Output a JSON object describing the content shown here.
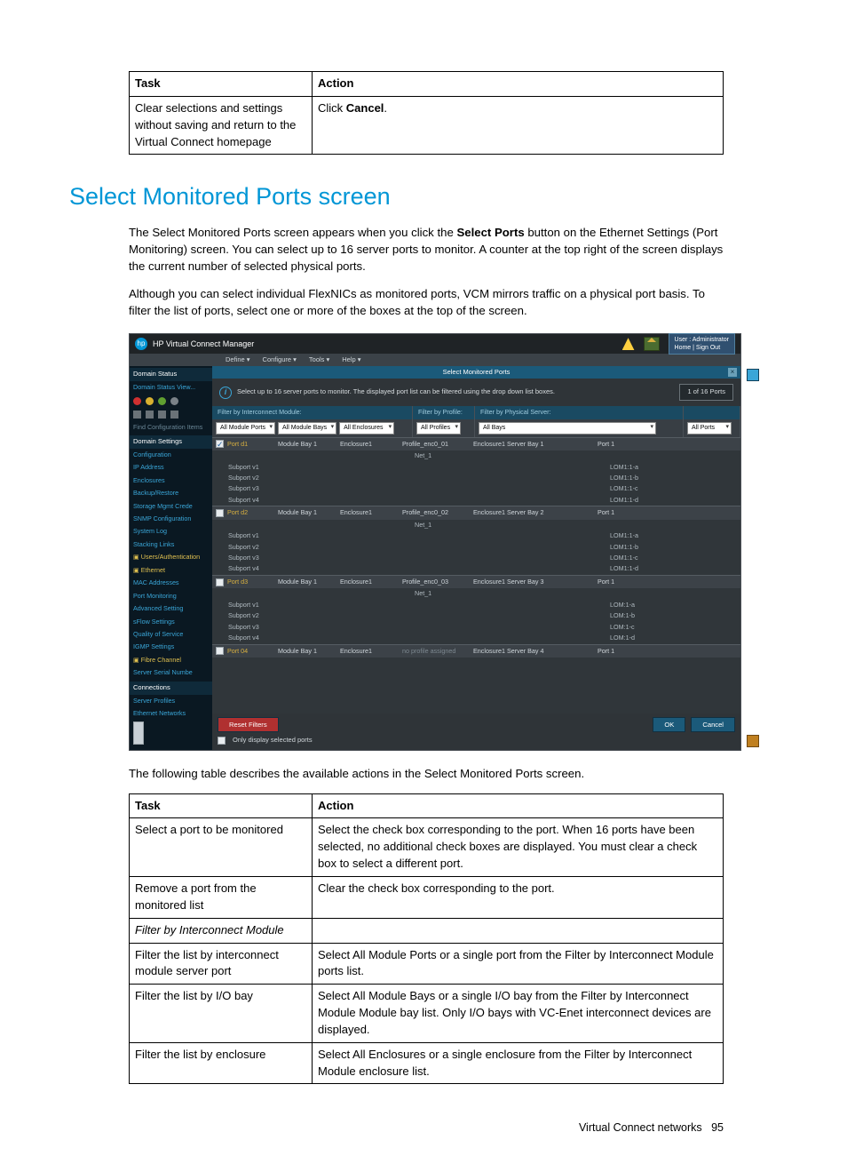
{
  "top_table": {
    "headers": [
      "Task",
      "Action"
    ],
    "rows": [
      {
        "task": "Clear selections and settings without saving and return to the Virtual Connect homepage",
        "action_pre": "Click ",
        "action_strong": "Cancel",
        "action_post": "."
      }
    ]
  },
  "section_title": "Select Monitored Ports screen",
  "para1_pre": "The Select Monitored Ports screen appears when you click the ",
  "para1_strong": "Select Ports",
  "para1_post": " button on the Ethernet Settings (Port Monitoring) screen. You can select up to 16 server ports to monitor. A counter at the top right of the screen displays the current number of selected physical ports.",
  "para2": "Although you can select individual FlexNICs as monitored ports, VCM mirrors traffic on a physical port basis. To filter the list of ports, select one or more of the boxes at the top of the screen.",
  "para3": "The following table describes the available actions in the Select Monitored Ports screen.",
  "screenshot": {
    "app_title": "HP Virtual Connect Manager",
    "user_line1": "User : Administrator",
    "user_line2": "Home | Sign Out",
    "menubar": [
      "Define ▾",
      "Configure ▾",
      "Tools ▾",
      "Help ▾"
    ],
    "crumb": "Select Monitored Ports",
    "sidebar": {
      "domain_status": "Domain Status",
      "view_link": "Domain Status   View...",
      "find_hdr": "Find Configuration Items",
      "domain_settings": "Domain Settings",
      "ds_items": [
        "Configuration",
        "IP Address",
        "Enclosures",
        "Backup/Restore",
        "Storage Mgmt Crede",
        "SNMP Configuration",
        "System Log",
        "Stacking Links"
      ],
      "users": "Users/Authentication",
      "ethernet": "Ethernet",
      "eth_items": [
        "MAC Addresses",
        "Port Monitoring",
        "Advanced Setting",
        "sFlow Settings",
        "Quality of Service",
        "IGMP Settings"
      ],
      "fc": "Fibre Channel",
      "fc_items": [
        "Server Serial Numbe"
      ],
      "conn": "Connections",
      "conn_items": [
        "Server Profiles",
        "Ethernet Networks"
      ]
    },
    "info_text": "Select up to 16 server ports to monitor. The displayed port list can be filtered using the drop down list boxes.",
    "counter": "1 of 16 Ports",
    "filters": {
      "f1_hdr": "Filter by Interconnect Module:",
      "f1_a": "All Module Ports",
      "f1_b": "All Module Bays",
      "f1_c": "All Enclosures",
      "f2_hdr": "Filter by Profile:",
      "f2_a": "All Profiles",
      "f3_hdr": "Filter by Physical Server:",
      "f3_a": "All Bays",
      "f4_a": "All Ports"
    },
    "ports": [
      {
        "checked": true,
        "port": "Port d1",
        "bay": "Module Bay 1",
        "enc": "Enclosure1",
        "profile": "Profile_enc0_01",
        "net": "Net_1",
        "srv": "Enclosure1 Server Bay 1",
        "right": "Port 1",
        "subs": [
          [
            "Subport v1",
            "LOM1:1-a"
          ],
          [
            "Subport v2",
            "LOM1:1-b"
          ],
          [
            "Subport v3",
            "LOM1:1-c"
          ],
          [
            "Subport v4",
            "LOM1:1-d"
          ]
        ]
      },
      {
        "checked": false,
        "port": "Port d2",
        "bay": "Module Bay 1",
        "enc": "Enclosure1",
        "profile": "Profile_enc0_02",
        "net": "Net_1",
        "srv": "Enclosure1 Server Bay 2",
        "right": "Port 1",
        "subs": [
          [
            "Subport v1",
            "LOM1:1-a"
          ],
          [
            "Subport v2",
            "LOM1:1-b"
          ],
          [
            "Subport v3",
            "LOM1:1-c"
          ],
          [
            "Subport v4",
            "LOM1:1-d"
          ]
        ]
      },
      {
        "checked": false,
        "port": "Port d3",
        "bay": "Module Bay 1",
        "enc": "Enclosure1",
        "profile": "Profile_enc0_03",
        "net": "Net_1",
        "srv": "Enclosure1 Server Bay 3",
        "right": "Port 1",
        "subs": [
          [
            "Subport v1",
            "LOM:1-a"
          ],
          [
            "Subport v2",
            "LOM:1-b"
          ],
          [
            "Subport v3",
            "LOM:1-c"
          ],
          [
            "Subport v4",
            "LOM:1-d"
          ]
        ]
      },
      {
        "checked": false,
        "port": "Port 04",
        "bay": "Module Bay 1",
        "enc": "Enclosure1",
        "profile": "no profile assigned",
        "net": "",
        "srv": "Enclosure1 Server Bay 4",
        "right": "Port 1",
        "subs": []
      }
    ],
    "no_profile": "no profile assigned",
    "reset": "Reset Filters",
    "ok": "OK",
    "cancel": "Cancel",
    "only_sel": "Only display selected ports"
  },
  "actions_table": {
    "headers": [
      "Task",
      "Action"
    ],
    "rows": [
      {
        "task": "Select a port to be monitored",
        "action": "Select the check box corresponding to the port. When 16 ports have been selected, no additional check boxes are displayed. You must clear a check box to select a different port."
      },
      {
        "task": "Remove a port from the monitored list",
        "action": "Clear the check box corresponding to the port."
      },
      {
        "task_italic": "Filter by Interconnect Module",
        "action": ""
      },
      {
        "task": "Filter the list by interconnect module server port",
        "action": "Select All Module Ports or a single port from the Filter by Interconnect Module ports list."
      },
      {
        "task": "Filter the list by I/O bay",
        "action": "Select All Module Bays or a single I/O bay from the Filter by Interconnect Module Module bay list. Only I/O bays with VC-Enet interconnect devices are displayed."
      },
      {
        "task": "Filter the list by enclosure",
        "action": "Select All Enclosures or a single   enclosure from the Filter by Interconnect Module enclosure list."
      }
    ]
  },
  "footer": {
    "label": "Virtual Connect networks",
    "page": "95"
  }
}
